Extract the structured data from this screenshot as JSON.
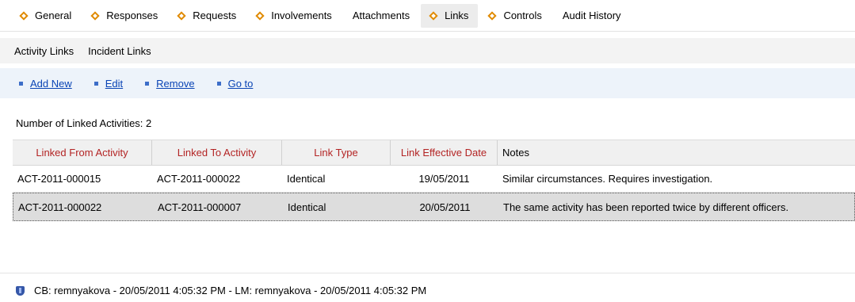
{
  "tabs": [
    {
      "label": "General",
      "icon": "diamond-icon",
      "active": false
    },
    {
      "label": "Responses",
      "icon": "diamond-icon",
      "active": false
    },
    {
      "label": "Requests",
      "icon": "diamond-icon",
      "active": false
    },
    {
      "label": "Involvements",
      "icon": "diamond-icon",
      "active": false
    },
    {
      "label": "Attachments",
      "icon": "",
      "active": false
    },
    {
      "label": "Links",
      "icon": "diamond-icon",
      "active": true
    },
    {
      "label": "Controls",
      "icon": "diamond-icon",
      "active": false
    },
    {
      "label": "Audit History",
      "icon": "",
      "active": false
    }
  ],
  "subtabs": [
    "Activity Links",
    "Incident Links"
  ],
  "toolbar": {
    "add_label": "Add New",
    "edit_label": "Edit",
    "remove_label": "Remove",
    "goto_label": "Go to"
  },
  "count_text": "Number of Linked Activities: 2",
  "grid": {
    "columns": [
      "Linked From Activity",
      "Linked To Activity",
      "Link Type",
      "Link Effective Date",
      "Notes"
    ],
    "rows": [
      {
        "from": "ACT-2011-000015",
        "to": "ACT-2011-000022",
        "type": "Identical",
        "date": "19/05/2011",
        "notes": "Similar circumstances. Requires investigation."
      },
      {
        "from": "ACT-2011-000022",
        "to": "ACT-2011-000007",
        "type": "Identical",
        "date": "20/05/2011",
        "notes": "The same activity has been reported twice by different officers."
      }
    ]
  },
  "status": {
    "icon": "shield-icon",
    "text": "CB: remnyakova - 20/05/2011 4:05:32 PM - LM: remnyakova - 20/05/2011 4:05:32 PM"
  },
  "colors": {
    "accent_diamond": "#e08a00",
    "header_text": "#b32424",
    "link": "#0a44b5"
  }
}
